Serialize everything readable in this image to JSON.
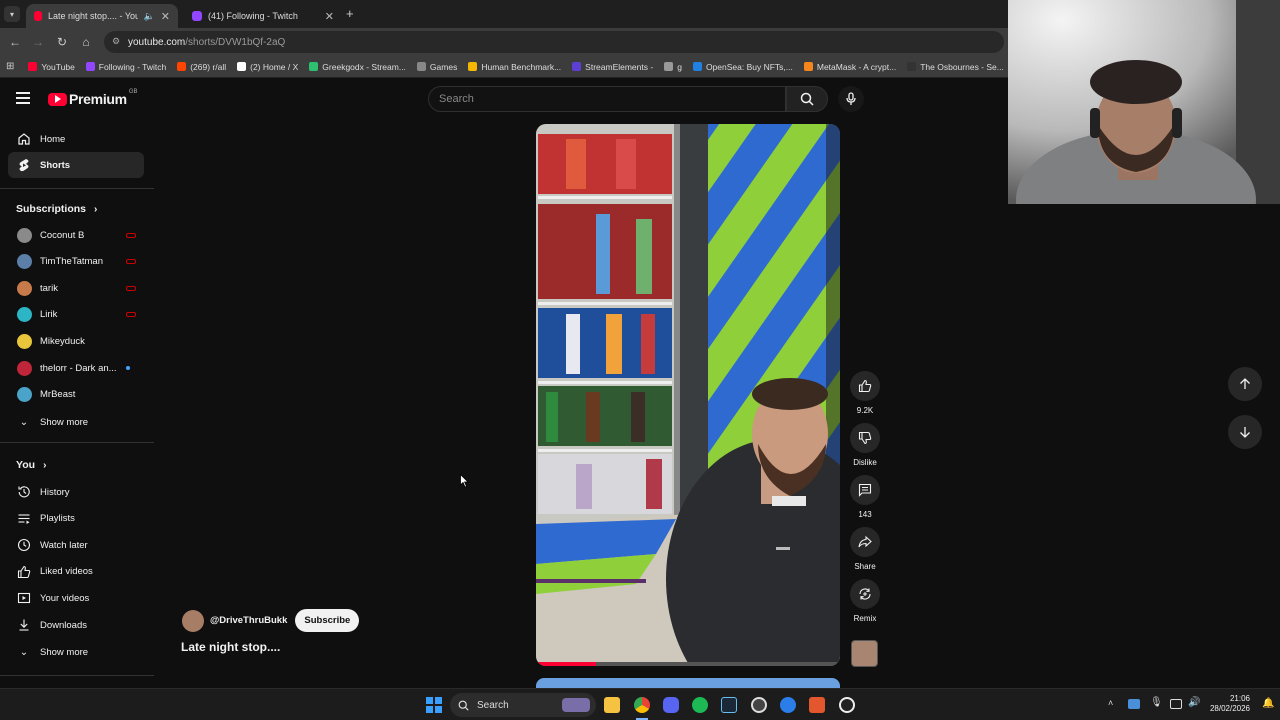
{
  "browser": {
    "tabs": [
      {
        "title": "Late night stop.... - YouTube",
        "active": true,
        "color": "#ff0033"
      },
      {
        "title": "(41) Following - Twitch",
        "active": false,
        "color": "#9146ff"
      }
    ],
    "url_host": "youtube.com",
    "url_path": "/shorts/DVW1bQf-2aQ",
    "bookmarks": [
      {
        "label": "YouTube",
        "color": "#ff0033"
      },
      {
        "label": "Following - Twitch",
        "color": "#9146ff"
      },
      {
        "label": "(269) r/all",
        "color": "#ff4500"
      },
      {
        "label": "(2) Home / X",
        "color": "#ffffff"
      },
      {
        "label": "Greekgodx - Stream...",
        "color": "#2fbf71"
      },
      {
        "label": "Games",
        "color": "#888888"
      },
      {
        "label": "Human Benchmark...",
        "color": "#f5b700"
      },
      {
        "label": "StreamElements -",
        "color": "#5d3fd3"
      },
      {
        "label": "g",
        "color": "#999999"
      },
      {
        "label": "OpenSea: Buy NFTs,...",
        "color": "#2081e2"
      },
      {
        "label": "MetaMask - A crypt...",
        "color": "#f6851b"
      },
      {
        "label": "The Osbournes - Se...",
        "color": "#333333"
      }
    ]
  },
  "youtube": {
    "logo": "Premium",
    "region": "GB",
    "search_placeholder": "Search",
    "sidebar": {
      "main": [
        {
          "label": "Home",
          "icon": "home-icon",
          "active": false
        },
        {
          "label": "Shorts",
          "icon": "shorts-icon",
          "active": true
        }
      ],
      "subscriptions_header": "Subscriptions",
      "subscriptions": [
        {
          "label": "Coconut B",
          "color": "#8a8a8a",
          "live": true
        },
        {
          "label": "TimTheTatman",
          "color": "#5b7fa8",
          "live": true
        },
        {
          "label": "tarik",
          "color": "#c77a4a",
          "live": true
        },
        {
          "label": "Lirik",
          "color": "#2bb5c5",
          "live": true
        },
        {
          "label": "Mikeyduck",
          "color": "#e8c53a",
          "live": false
        },
        {
          "label": "thelorr - Dark an...",
          "color": "#c0263a",
          "live": false,
          "new": true
        },
        {
          "label": "MrBeast",
          "color": "#4aa3c8",
          "live": false
        }
      ],
      "subs_show_more": "Show more",
      "you_header": "You",
      "you_items": [
        {
          "label": "History",
          "icon": "history-icon"
        },
        {
          "label": "Playlists",
          "icon": "playlists-icon"
        },
        {
          "label": "Watch later",
          "icon": "watch-later-icon"
        },
        {
          "label": "Liked videos",
          "icon": "like-icon"
        },
        {
          "label": "Your videos",
          "icon": "your-videos-icon"
        },
        {
          "label": "Downloads",
          "icon": "download-icon"
        }
      ],
      "you_show_more": "Show more"
    },
    "short": {
      "channel": "@DriveThruBukk",
      "subscribe": "Subscribe",
      "title": "Late night stop....",
      "likes": "9.2K",
      "dislike": "Dislike",
      "comments": "143",
      "share": "Share",
      "remix": "Remix"
    }
  },
  "taskbar": {
    "search": "Search",
    "time": "21:06",
    "date": "28/02/2026"
  }
}
